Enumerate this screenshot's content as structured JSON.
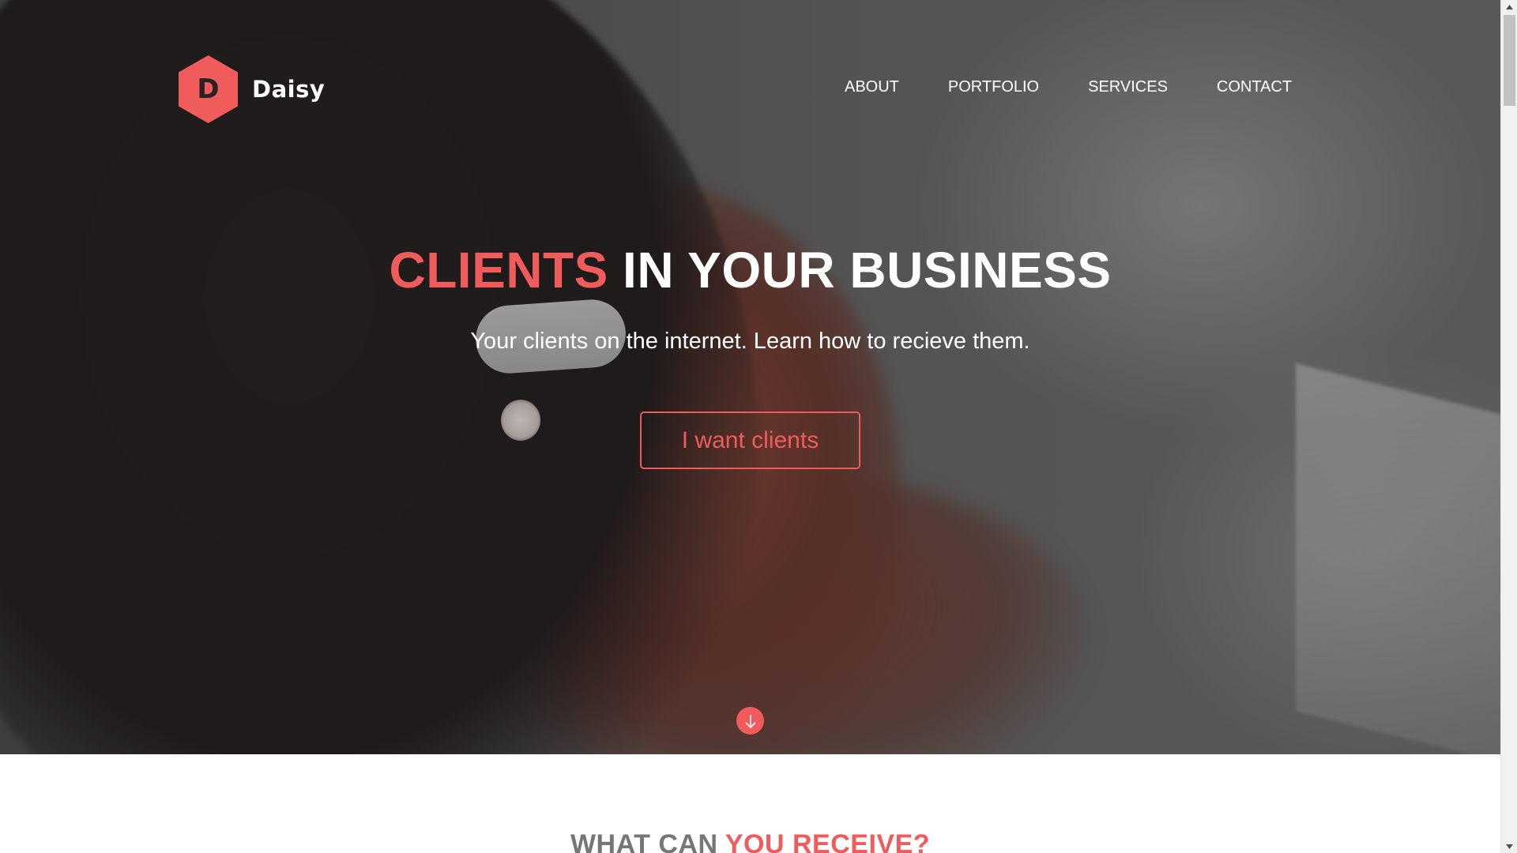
{
  "brand": {
    "logo_letter": "D",
    "name": "Daisy"
  },
  "nav": {
    "items": [
      {
        "label": "ABOUT"
      },
      {
        "label": "PORTFOLIO"
      },
      {
        "label": "SERVICES"
      },
      {
        "label": "CONTACT"
      }
    ]
  },
  "hero": {
    "headline_accent": "CLIENTS",
    "headline_rest": "IN YOUR BUSINESS",
    "subtitle": "Your clients on the internet. Learn how to recieve them.",
    "cta_label": "I want clients",
    "scroll_icon": "arrow-down-icon"
  },
  "section": {
    "title_plain": "WHAT CAN",
    "title_accent": "YOU RECEIVE?"
  },
  "colors": {
    "accent": "#f05c5c",
    "text_light": "#ffffff",
    "section_title": "#767676"
  }
}
